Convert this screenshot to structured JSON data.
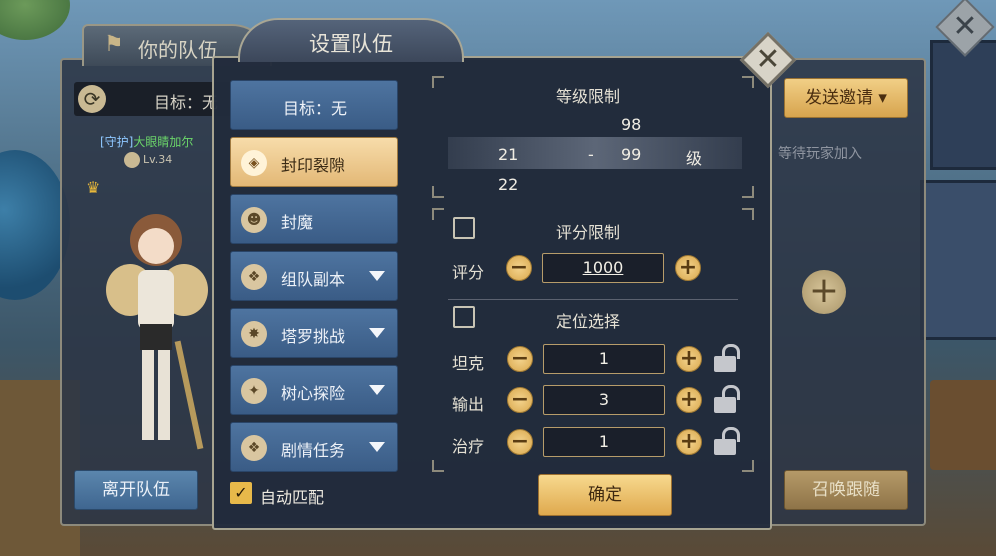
{
  "team_panel": {
    "title": "你的队伍",
    "target_text": "目标：无",
    "member": {
      "role_tag": "[守护]",
      "name": "大眼睛加尔",
      "level": "Lv.34"
    },
    "leave_label": "离开队伍",
    "send_invite_label": "发送邀请",
    "waiting_text": "等待玩家加入",
    "summon_label": "召唤跟随",
    "add_symbol": "+",
    "close_symbol": "✕"
  },
  "dialog": {
    "title": "设置队伍",
    "close_symbol": "✕",
    "categories": [
      {
        "label": "目标：无",
        "icon": "none",
        "active": false,
        "dropdown": false
      },
      {
        "label": "封印裂隙",
        "icon": "rift-icon",
        "active": true,
        "dropdown": false
      },
      {
        "label": "封魔",
        "icon": "demon-seal-icon",
        "active": false,
        "dropdown": false
      },
      {
        "label": "组队副本",
        "icon": "dungeon-icon",
        "active": false,
        "dropdown": true
      },
      {
        "label": "塔罗挑战",
        "icon": "tarot-icon",
        "active": false,
        "dropdown": true
      },
      {
        "label": "树心探险",
        "icon": "tree-heart-icon",
        "active": false,
        "dropdown": true
      },
      {
        "label": "剧情任务",
        "icon": "story-icon",
        "active": false,
        "dropdown": true
      }
    ],
    "auto_match": {
      "label": "自动匹配",
      "checked": true
    },
    "level_limit": {
      "title": "等级限制",
      "above": "98",
      "min": "21",
      "separator": "-",
      "max": "99",
      "unit": "级",
      "below": "22"
    },
    "score_limit": {
      "title": "评分限制",
      "checked": false,
      "label": "评分",
      "value": "1000"
    },
    "position": {
      "title": "定位选择",
      "checked": false,
      "rows": [
        {
          "label": "坦克",
          "value": "1"
        },
        {
          "label": "输出",
          "value": "3"
        },
        {
          "label": "治疗",
          "value": "1"
        }
      ]
    },
    "minus_symbol": "−",
    "plus_symbol": "+",
    "confirm_label": "确定"
  },
  "colors": {
    "accent_gold": "#e3b876",
    "button_blue": "#4e74a0",
    "panel_bg": "#222b3c"
  }
}
